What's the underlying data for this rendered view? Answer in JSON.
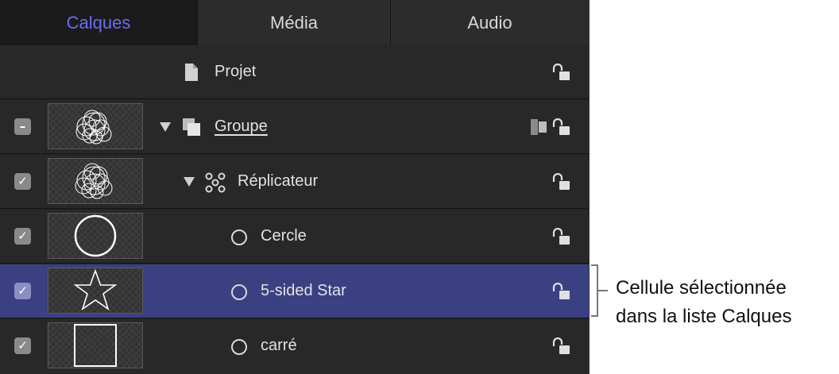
{
  "tabs": [
    {
      "label": "Calques",
      "active": true
    },
    {
      "label": "Média",
      "active": false
    },
    {
      "label": "Audio",
      "active": false
    }
  ],
  "colors": {
    "active_tab": "#6a6cf5",
    "selected_row": "#3a4082",
    "panel_bg": "#252525"
  },
  "layers": [
    {
      "name": "Projet",
      "icon": "document-icon",
      "locked": false
    },
    {
      "name": "Groupe",
      "icon": "group-icon",
      "expanded": true,
      "checkbox": "mixed",
      "thumbnail": "scribble",
      "locked": false
    },
    {
      "name": "Réplicateur",
      "icon": "replicator-icon",
      "expanded": true,
      "checkbox": "checked",
      "thumbnail": "scribble",
      "locked": false
    },
    {
      "name": "Cercle",
      "icon": "shape-circle-icon",
      "checkbox": "checked",
      "thumbnail": "circle",
      "locked": false
    },
    {
      "name": "5-sided Star",
      "icon": "shape-circle-icon",
      "checkbox": "checked",
      "thumbnail": "star",
      "selected": true,
      "locked": false
    },
    {
      "name": "carré",
      "icon": "shape-circle-icon",
      "checkbox": "checked",
      "thumbnail": "square",
      "locked": false
    }
  ],
  "callout": {
    "line1": "Cellule sélectionnée",
    "line2": "dans la liste Calques"
  }
}
